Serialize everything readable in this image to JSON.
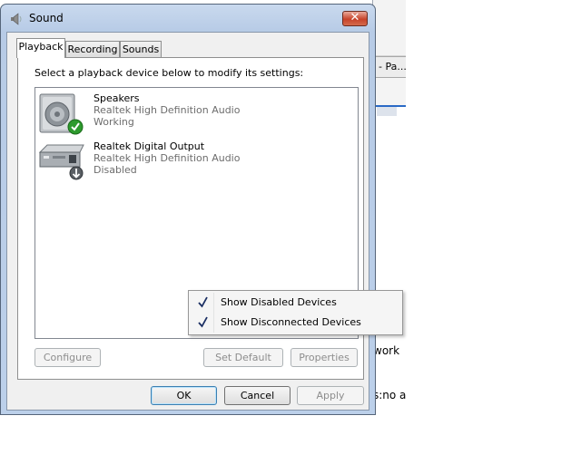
{
  "dialog": {
    "title": "Sound",
    "close_label": "✕",
    "tabs": [
      {
        "label": "Playback",
        "active": true
      },
      {
        "label": "Recording",
        "active": false
      },
      {
        "label": "Sounds",
        "active": false
      }
    ],
    "instruction": "Select a playback device below to modify its settings:",
    "devices": [
      {
        "name": "Speakers",
        "driver": "Realtek High Definition Audio",
        "status": "Working",
        "icon": "speaker-icon",
        "badge": "check-icon"
      },
      {
        "name": "Realtek Digital Output",
        "driver": "Realtek High Definition Audio",
        "status": "Disabled",
        "icon": "digital-output-icon",
        "badge": "disabled-arrow-icon"
      }
    ],
    "buttons": {
      "configure": "Configure",
      "set_default": "Set Default",
      "properties": "Properties",
      "ok": "OK",
      "cancel": "Cancel",
      "apply": "Apply"
    }
  },
  "context_menu": {
    "items": [
      {
        "label": "Show Disabled Devices",
        "checked": true
      },
      {
        "label": "Show Disconnected Devices",
        "checked": true
      }
    ]
  },
  "background_window": {
    "tab_label": "- Pa...",
    "text_work": "work",
    "text_no": "s:no a"
  },
  "colors": {
    "frame": "#bcd0ea",
    "close": "#c7432a",
    "check": "#2a8a2a",
    "default_button": "#3c7fb1"
  }
}
